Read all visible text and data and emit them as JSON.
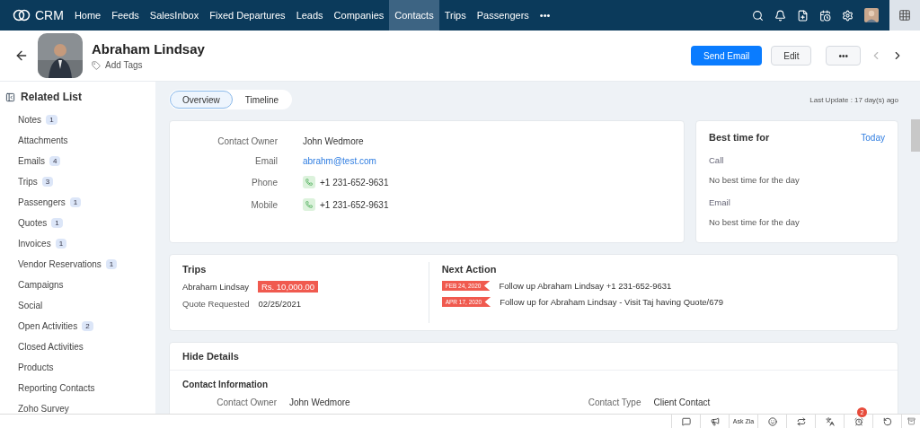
{
  "nav": {
    "logo": "CRM",
    "more": "•••",
    "items": [
      {
        "label": "Home",
        "selected": false
      },
      {
        "label": "Feeds",
        "selected": false
      },
      {
        "label": "SalesInbox",
        "selected": false
      },
      {
        "label": "Fixed Departures",
        "selected": false
      },
      {
        "label": "Leads",
        "selected": false
      },
      {
        "label": "Companies",
        "selected": false
      },
      {
        "label": "Contacts",
        "selected": true
      },
      {
        "label": "Trips",
        "selected": false
      },
      {
        "label": "Passengers",
        "selected": false
      }
    ]
  },
  "header": {
    "name": "Abraham Lindsay",
    "add_tags": "Add Tags",
    "send_email": "Send Email",
    "edit": "Edit",
    "more": "•••"
  },
  "sidebar": {
    "title": "Related List",
    "items": [
      {
        "label": "Notes",
        "count": "1"
      },
      {
        "label": "Attachments"
      },
      {
        "label": "Emails",
        "count": "4"
      },
      {
        "label": "Trips",
        "count": "3"
      },
      {
        "label": "Passengers",
        "count": "1"
      },
      {
        "label": "Quotes",
        "count": "1"
      },
      {
        "label": "Invoices",
        "count": "1"
      },
      {
        "label": "Vendor Reservations",
        "count": "1"
      },
      {
        "label": "Campaigns"
      },
      {
        "label": "Social"
      },
      {
        "label": "Open Activities",
        "count": "2"
      },
      {
        "label": "Closed Activities"
      },
      {
        "label": "Products"
      },
      {
        "label": "Reporting Contacts"
      },
      {
        "label": "Zoho Survey"
      }
    ]
  },
  "tabs": [
    {
      "label": "Overview",
      "selected": true
    },
    {
      "label": "Timeline",
      "selected": false
    }
  ],
  "last_update": "Last Update : 17 day(s) ago",
  "contact_fields": [
    {
      "label": "Contact Owner",
      "value": "John Wedmore",
      "kind": "text"
    },
    {
      "label": "Email",
      "value": "abrahm@test.com",
      "kind": "link"
    },
    {
      "label": "Phone",
      "value": "+1 231-652-9631",
      "kind": "phone"
    },
    {
      "label": "Mobile",
      "value": "+1 231-652-9631",
      "kind": "phone"
    }
  ],
  "best_time": {
    "title": "Best time for",
    "link": "Today",
    "sections": [
      {
        "label": "Call",
        "value": "No best time for the day"
      },
      {
        "label": "Email",
        "value": "No best time for the day"
      }
    ]
  },
  "trips": {
    "title": "Trips",
    "name": "Abraham Lindsay",
    "amount": "Rs. 10,000.00",
    "quote_label": "Quote Requested",
    "quote_date": "02/25/2021"
  },
  "next_action": {
    "title": "Next Action",
    "items": [
      {
        "date": "FEB 24, 2020",
        "text": "Follow up Abraham Lindsay +1 231-652-9631"
      },
      {
        "date": "APR 17, 2020",
        "text": "Follow up for Abraham Lindsay - Visit Taj having Quote/679"
      }
    ]
  },
  "details": {
    "title": "Hide Details",
    "section": "Contact Information",
    "fields": [
      {
        "label": "Contact Owner",
        "value": "John Wedmore"
      },
      {
        "label": "Contact Type",
        "value": "Client Contact"
      }
    ]
  },
  "bottom_bar": {
    "ask_zia": "Ask Zia",
    "badge": "2"
  }
}
